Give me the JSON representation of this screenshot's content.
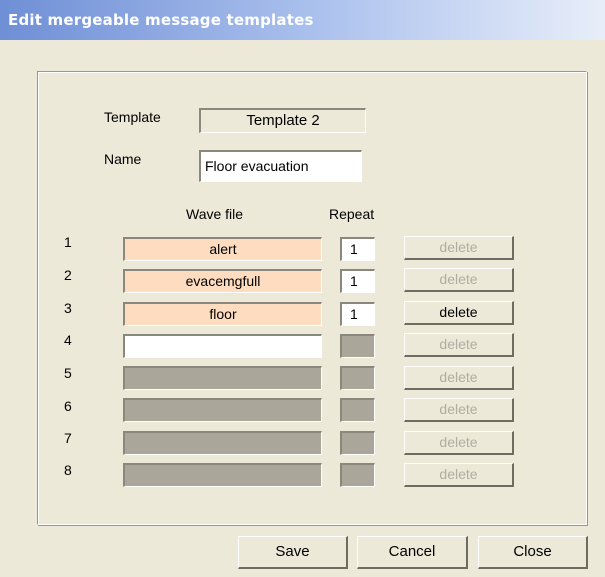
{
  "window": {
    "title": "Edit mergeable message templates"
  },
  "form": {
    "template_label": "Template",
    "template_value": "Template 2",
    "name_label": "Name",
    "name_value": "Floor evacuation"
  },
  "table": {
    "wave_header": "Wave file",
    "repeat_header": "Repeat",
    "delete_label": "delete",
    "rows": [
      {
        "num": "1",
        "wave": "alert",
        "repeat": "1"
      },
      {
        "num": "2",
        "wave": "evacemgfull",
        "repeat": "1"
      },
      {
        "num": "3",
        "wave": "floor",
        "repeat": "1"
      },
      {
        "num": "4",
        "wave": "",
        "repeat": ""
      },
      {
        "num": "5",
        "wave": "",
        "repeat": ""
      },
      {
        "num": "6",
        "wave": "",
        "repeat": ""
      },
      {
        "num": "7",
        "wave": "",
        "repeat": ""
      },
      {
        "num": "8",
        "wave": "",
        "repeat": ""
      }
    ]
  },
  "buttons": {
    "save": "Save",
    "cancel": "Cancel",
    "close": "Close"
  },
  "colors": {
    "window_bg": "#ece9d8",
    "title_gradient_start": "#6f8fd6",
    "filled_wave_bg": "#fddcbf",
    "disabled_field_bg": "#aaa699",
    "disabled_text": "#b0ada2"
  }
}
